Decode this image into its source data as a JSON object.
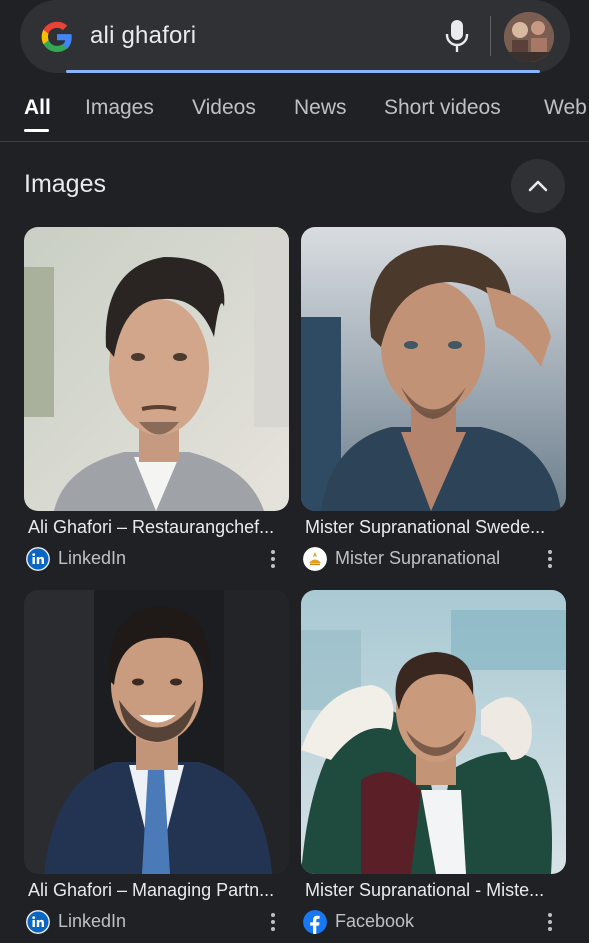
{
  "search": {
    "query": "ali ghafori"
  },
  "tabs": [
    {
      "label": "All",
      "active": true
    },
    {
      "label": "Images",
      "active": false
    },
    {
      "label": "Videos",
      "active": false
    },
    {
      "label": "News",
      "active": false
    },
    {
      "label": "Short videos",
      "active": false
    },
    {
      "label": "Web",
      "active": false
    }
  ],
  "images_section": {
    "title": "Images",
    "results": [
      {
        "caption": "Ali Ghafori – Restaurangchef...",
        "source": "LinkedIn",
        "source_icon": "linkedin-icon"
      },
      {
        "caption": "Mister Supranational Swede...",
        "source": "Mister Supranational",
        "source_icon": "mister-supranational-icon"
      },
      {
        "caption": "Ali Ghafori – Managing Partn...",
        "source": "LinkedIn",
        "source_icon": "linkedin-icon"
      },
      {
        "caption": "Mister Supranational - Miste...",
        "source": "Facebook",
        "source_icon": "facebook-icon"
      }
    ]
  },
  "colors": {
    "background": "#202124",
    "surface": "#303134",
    "accent": "#8ab4f8",
    "linkedin": "#0a66c2",
    "facebook": "#1877f2"
  }
}
